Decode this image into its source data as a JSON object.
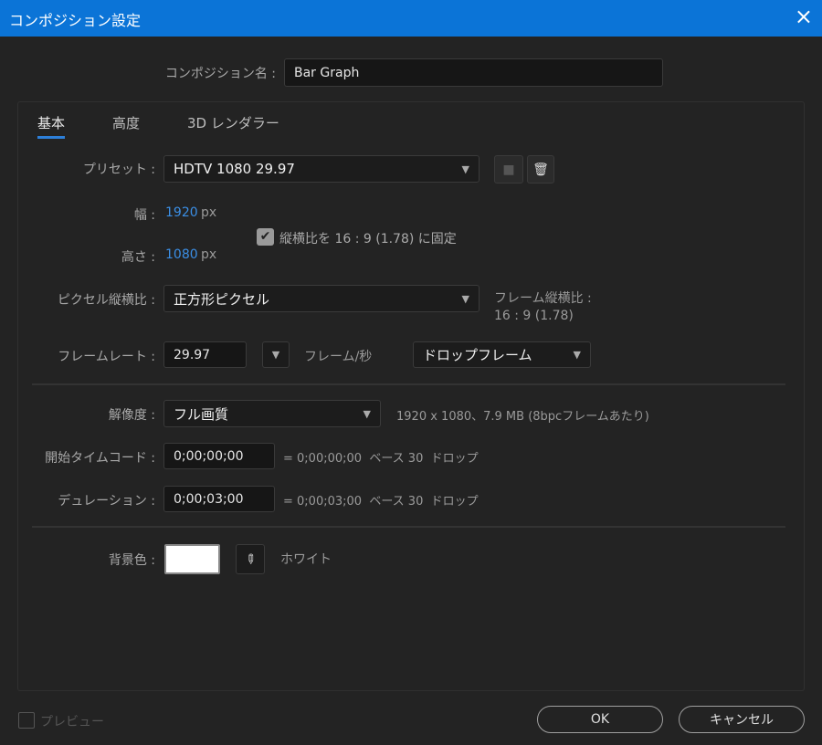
{
  "window": {
    "title": "コンポジション設定",
    "close_icon": "×"
  },
  "comp_name": {
    "label": "コンポジション名 :",
    "value": "Bar Graph"
  },
  "tabs": [
    {
      "label": "基本"
    },
    {
      "label": "高度"
    },
    {
      "label": "3D レンダラー"
    }
  ],
  "preset": {
    "label": "プリセット :",
    "value": "HDTV 1080 29.97"
  },
  "width": {
    "label": "幅 :",
    "value": "1920",
    "unit": "px"
  },
  "height": {
    "label": "高さ :",
    "value": "1080",
    "unit": "px"
  },
  "lock_aspect": {
    "label": "縦横比を 16 : 9 (1.78) に固定",
    "checked": true
  },
  "pixel_aspect": {
    "label": "ピクセル縦横比 :",
    "value": "正方形ピクセル"
  },
  "frame_aspect": {
    "label": "フレーム縦横比 :",
    "value": "16 : 9 (1.78)"
  },
  "frame_rate": {
    "label": "フレームレート :",
    "value": "29.97",
    "unit": "フレーム/秒",
    "drop": "ドロップフレーム"
  },
  "resolution": {
    "label": "解像度 :",
    "value": "フル画質",
    "info": "1920 x 1080、7.9 MB (8bpcフレームあたり)"
  },
  "start_timecode": {
    "label": "開始タイムコード :",
    "value": "0;00;00;00",
    "info": "= 0;00;00;00  ベース 30  ドロップ"
  },
  "duration": {
    "label": "デュレーション :",
    "value": "0;00;03;00",
    "info": "= 0;00;03;00  ベース 30  ドロップ"
  },
  "background": {
    "label": "背景色 :",
    "color": "#ffffff",
    "name": "ホワイト"
  },
  "footer": {
    "preview": "プレビュー",
    "ok": "OK",
    "cancel": "キャンセル"
  },
  "colors": {
    "accent": "#0b74d7",
    "value_blue": "#3b8fe6"
  }
}
